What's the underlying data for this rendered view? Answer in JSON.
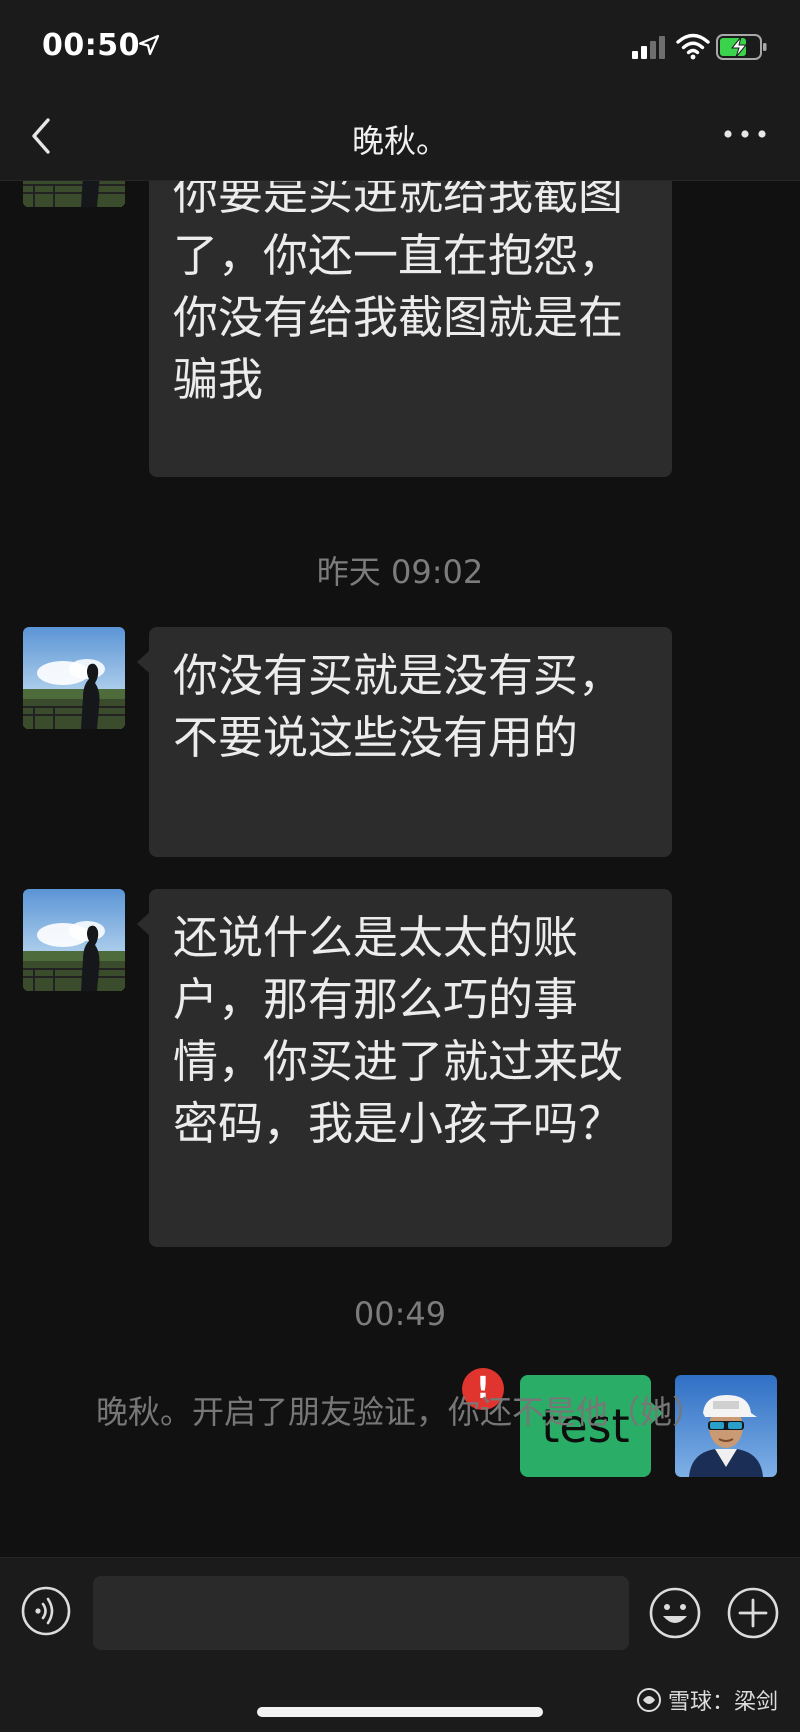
{
  "status_bar": {
    "time": "00:50"
  },
  "header": {
    "title": "晚秋。"
  },
  "messages": [
    {
      "side": "left",
      "text": "你根本就是没有买进，你要是买进就给我截图了，你还一直在抱怨，你没有给我截图就是在骗我"
    },
    {
      "type": "timestamp",
      "text": "昨天 09:02"
    },
    {
      "side": "left",
      "text": "你没有买就是没有买，不要说这些没有用的"
    },
    {
      "side": "left",
      "text": "还说什么是太太的账户，那有那么巧的事情，你买进了就过来改密码，我是小孩子吗？"
    },
    {
      "type": "timestamp",
      "text": "00:49"
    },
    {
      "side": "right",
      "text": "test",
      "failed": true
    }
  ],
  "system_notice": "晚秋。开启了朋友验证，你还不是他（她）",
  "input_bar": {
    "text_value": ""
  },
  "watermark": {
    "text": "雪球：梁剑"
  },
  "colors": {
    "background": "#111111",
    "bar_background": "#1b1b1b",
    "received_bubble": "#2c2c2c",
    "sent_bubble": "#2aae67",
    "error_red": "#e0352e"
  }
}
